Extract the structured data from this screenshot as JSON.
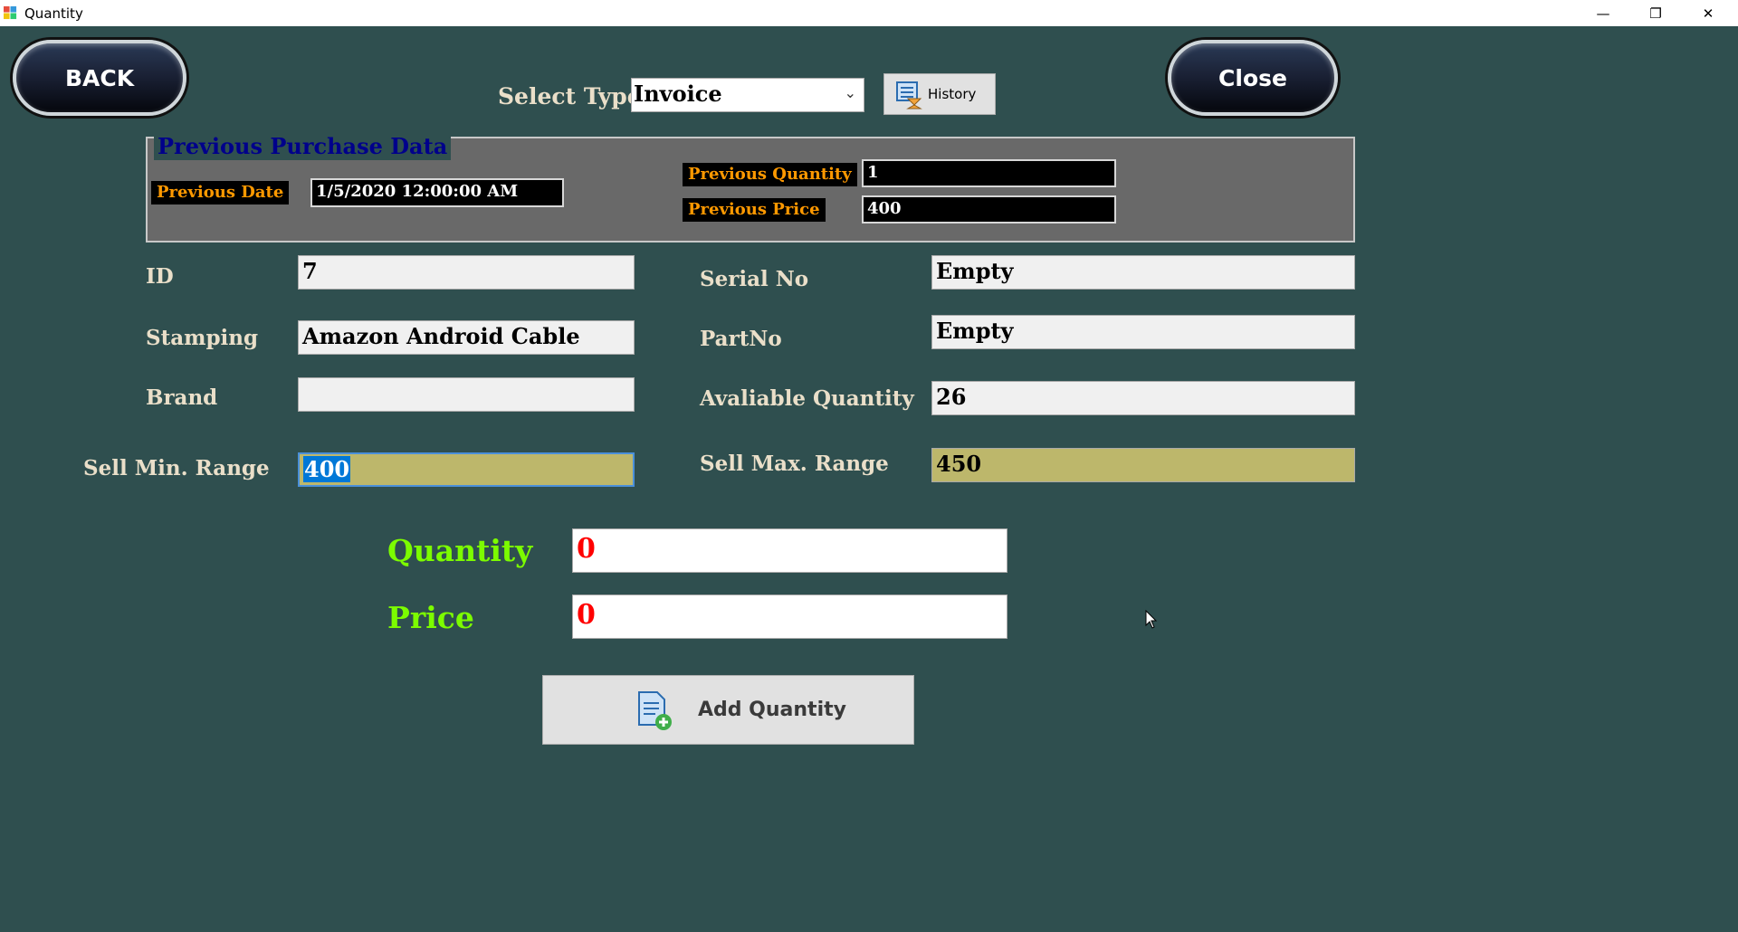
{
  "window": {
    "title": "Quantity",
    "controls": {
      "minimize": "—",
      "restore": "❐",
      "close": "✕"
    }
  },
  "nav": {
    "back_label": "BACK",
    "close_label": "Close"
  },
  "select_type": {
    "label": "Select Type",
    "value": "Invoice"
  },
  "history_button": {
    "label": "History"
  },
  "previous_purchase": {
    "title": "Previous Purchase Data",
    "date_label": "Previous Date",
    "date_value": "1/5/2020 12:00:00 AM",
    "quantity_label": "Previous Quantity",
    "quantity_value": "1",
    "price_label": "Previous Price",
    "price_value": "400"
  },
  "fields": {
    "id_label": "ID",
    "id_value": "7",
    "stamping_label": "Stamping",
    "stamping_value": "Amazon Android Cable",
    "brand_label": "Brand",
    "brand_value": "",
    "sell_min_label": "Sell Min. Range",
    "sell_min_value": "400",
    "serial_label": "Serial No",
    "serial_value": "Empty",
    "partno_label": "PartNo",
    "partno_value": "Empty",
    "available_label": "Avaliable Quantity",
    "available_value": "26",
    "sell_max_label": "Sell Max. Range",
    "sell_max_value": "450"
  },
  "entry": {
    "quantity_label": "Quantity",
    "quantity_value": "0",
    "price_label": "Price",
    "price_value": "0"
  },
  "add_button": {
    "label": "Add Quantity"
  },
  "colors": {
    "background": "#2f4f4f",
    "label_text": "#eadfc9",
    "groupbox_title": "#00008b",
    "tag_text": "#ff9900",
    "entry_label": "#7cfc00",
    "entry_value": "#ff0000",
    "range_field": "#bdb76b",
    "selection": "#0078d7"
  }
}
